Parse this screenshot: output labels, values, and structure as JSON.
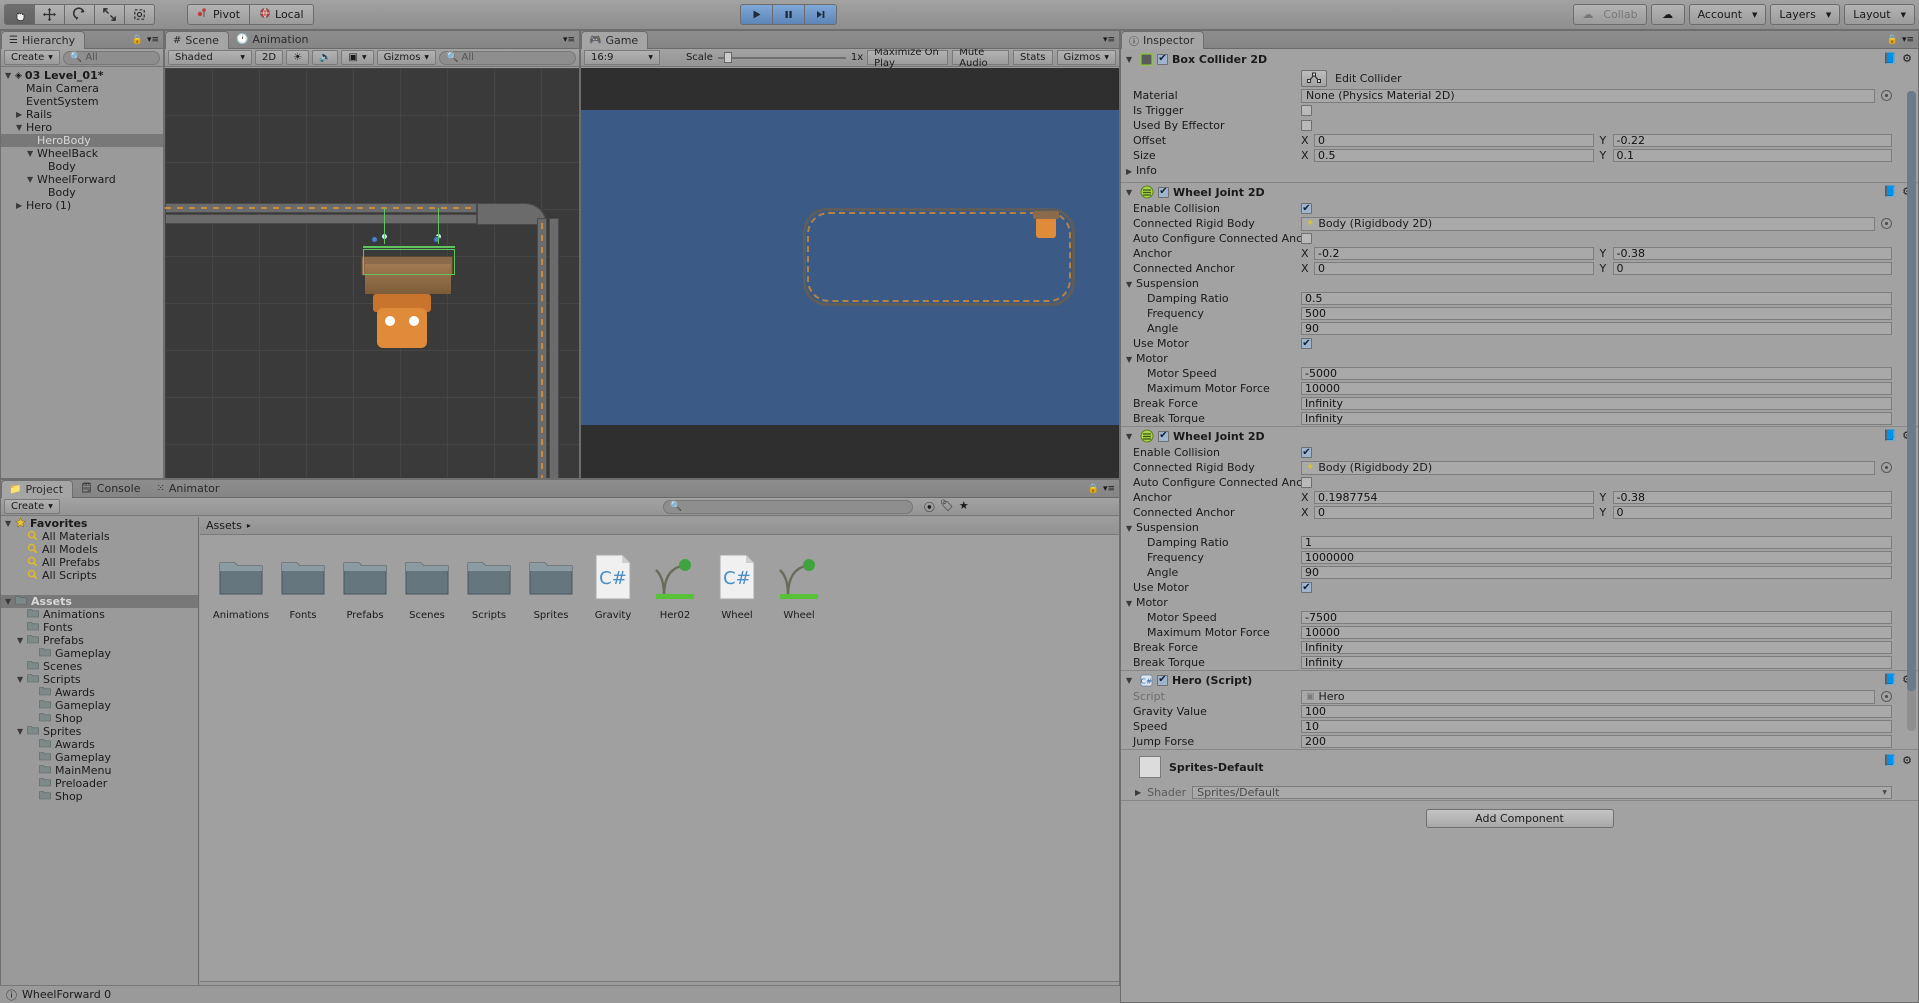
{
  "toolbar": {
    "tools": [
      {
        "name": "hand-tool",
        "glyph": "✋",
        "active": true
      },
      {
        "name": "move-tool",
        "glyph": "✥",
        "active": false
      },
      {
        "name": "rotate-tool",
        "glyph": "⟳",
        "active": false
      },
      {
        "name": "scale-tool",
        "glyph": "⤢",
        "active": false
      },
      {
        "name": "rect-tool",
        "glyph": "⬚",
        "active": false
      }
    ],
    "pivot_label": "Pivot",
    "local_label": "Local",
    "play_label": "▶",
    "pause_label": "❙❙",
    "step_label": "▶❙",
    "collab_label": "Collab",
    "account_label": "Account",
    "layers_label": "Layers",
    "layout_label": "Layout"
  },
  "hierarchy": {
    "tab": "Hierarchy",
    "create_label": "Create",
    "search_placeholder": "All",
    "items": [
      {
        "label": "03 Level_01*",
        "depth": 0,
        "arrow": "▼",
        "bold": true,
        "selected": false,
        "icon": "unity-scene-icon"
      },
      {
        "label": "Main Camera",
        "depth": 1,
        "arrow": "",
        "bold": false,
        "selected": false,
        "icon": ""
      },
      {
        "label": "EventSystem",
        "depth": 1,
        "arrow": "",
        "bold": false,
        "selected": false,
        "icon": ""
      },
      {
        "label": "Rails",
        "depth": 1,
        "arrow": "▶",
        "bold": false,
        "selected": false,
        "icon": ""
      },
      {
        "label": "Hero",
        "depth": 1,
        "arrow": "▼",
        "bold": false,
        "selected": false,
        "icon": ""
      },
      {
        "label": "HeroBody",
        "depth": 2,
        "arrow": "",
        "bold": false,
        "selected": true,
        "icon": ""
      },
      {
        "label": "WheelBack",
        "depth": 2,
        "arrow": "▼",
        "bold": false,
        "selected": false,
        "icon": ""
      },
      {
        "label": "Body",
        "depth": 3,
        "arrow": "",
        "bold": false,
        "selected": false,
        "icon": ""
      },
      {
        "label": "WheelForward",
        "depth": 2,
        "arrow": "▼",
        "bold": false,
        "selected": false,
        "icon": ""
      },
      {
        "label": "Body",
        "depth": 3,
        "arrow": "",
        "bold": false,
        "selected": false,
        "icon": ""
      },
      {
        "label": "Hero (1)",
        "depth": 1,
        "arrow": "▶",
        "bold": false,
        "selected": false,
        "icon": ""
      }
    ]
  },
  "scene": {
    "tab": "Scene",
    "tab2": "Animation",
    "shading_mode": "Shaded",
    "mode_2d": "2D",
    "gizmos_label": "Gizmos",
    "gizmo_search_placeholder": "All"
  },
  "game": {
    "tab": "Game",
    "aspect": "16:9",
    "scale_label": "Scale",
    "scale_value": "1x",
    "maximize_label": "Maximize On Play",
    "mute_label": "Mute Audio",
    "stats_label": "Stats",
    "gizmos_label": "Gizmos"
  },
  "project": {
    "tabs": [
      "Project",
      "Console",
      "Animator"
    ],
    "selected_tab": "Project",
    "create_label": "Create",
    "search_placeholder": "",
    "breadcrumb": "Assets",
    "tree": [
      {
        "label": "Favorites",
        "depth": 0,
        "arrow": "▼",
        "icon": "star-icon",
        "bold": true,
        "selected": false
      },
      {
        "label": "All Materials",
        "depth": 1,
        "arrow": "",
        "icon": "search-icon",
        "bold": false,
        "selected": false
      },
      {
        "label": "All Models",
        "depth": 1,
        "arrow": "",
        "icon": "search-icon",
        "bold": false,
        "selected": false
      },
      {
        "label": "All Prefabs",
        "depth": 1,
        "arrow": "",
        "icon": "search-icon",
        "bold": false,
        "selected": false
      },
      {
        "label": "All Scripts",
        "depth": 1,
        "arrow": "",
        "icon": "search-icon",
        "bold": false,
        "selected": false
      },
      {
        "label": "",
        "depth": 0,
        "arrow": "",
        "icon": "",
        "bold": false,
        "selected": false
      },
      {
        "label": "Assets",
        "depth": 0,
        "arrow": "▼",
        "icon": "folder-icon",
        "bold": true,
        "selected": true
      },
      {
        "label": "Animations",
        "depth": 1,
        "arrow": "",
        "icon": "folder-icon",
        "bold": false,
        "selected": false
      },
      {
        "label": "Fonts",
        "depth": 1,
        "arrow": "",
        "icon": "folder-icon",
        "bold": false,
        "selected": false
      },
      {
        "label": "Prefabs",
        "depth": 1,
        "arrow": "▼",
        "icon": "folder-icon",
        "bold": false,
        "selected": false
      },
      {
        "label": "Gameplay",
        "depth": 2,
        "arrow": "",
        "icon": "folder-icon",
        "bold": false,
        "selected": false
      },
      {
        "label": "Scenes",
        "depth": 1,
        "arrow": "",
        "icon": "folder-icon",
        "bold": false,
        "selected": false
      },
      {
        "label": "Scripts",
        "depth": 1,
        "arrow": "▼",
        "icon": "folder-icon",
        "bold": false,
        "selected": false
      },
      {
        "label": "Awards",
        "depth": 2,
        "arrow": "",
        "icon": "folder-icon",
        "bold": false,
        "selected": false
      },
      {
        "label": "Gameplay",
        "depth": 2,
        "arrow": "",
        "icon": "folder-icon",
        "bold": false,
        "selected": false
      },
      {
        "label": "Shop",
        "depth": 2,
        "arrow": "",
        "icon": "folder-icon",
        "bold": false,
        "selected": false
      },
      {
        "label": "Sprites",
        "depth": 1,
        "arrow": "▼",
        "icon": "folder-icon",
        "bold": false,
        "selected": false
      },
      {
        "label": "Awards",
        "depth": 2,
        "arrow": "",
        "icon": "folder-icon",
        "bold": false,
        "selected": false
      },
      {
        "label": "Gameplay",
        "depth": 2,
        "arrow": "",
        "icon": "folder-icon",
        "bold": false,
        "selected": false
      },
      {
        "label": "MainMenu",
        "depth": 2,
        "arrow": "",
        "icon": "folder-icon",
        "bold": false,
        "selected": false
      },
      {
        "label": "Preloader",
        "depth": 2,
        "arrow": "",
        "icon": "folder-icon",
        "bold": false,
        "selected": false
      },
      {
        "label": "Shop",
        "depth": 2,
        "arrow": "",
        "icon": "folder-icon",
        "bold": false,
        "selected": false
      }
    ],
    "assets": [
      {
        "label": "Animations",
        "type": "folder"
      },
      {
        "label": "Fonts",
        "type": "folder"
      },
      {
        "label": "Prefabs",
        "type": "folder"
      },
      {
        "label": "Scenes",
        "type": "folder"
      },
      {
        "label": "Scripts",
        "type": "folder"
      },
      {
        "label": "Sprites",
        "type": "folder"
      },
      {
        "label": "Gravity",
        "type": "script"
      },
      {
        "label": "Her02",
        "type": "prefab"
      },
      {
        "label": "Wheel",
        "type": "script"
      },
      {
        "label": "Wheel",
        "type": "prefab"
      }
    ]
  },
  "statusbar": {
    "message": "WheelForward 0"
  },
  "inspector": {
    "tab": "Inspector",
    "add_component_label": "Add Component",
    "components": [
      {
        "name": "Box Collider 2D",
        "enabled": true,
        "icon": "box-collider-icon",
        "edit_collider_label": "Edit Collider",
        "rows": [
          {
            "label": "Material",
            "type": "object",
            "value": "None (Physics Material 2D)",
            "indent": 0
          },
          {
            "label": "Is Trigger",
            "type": "checkbox",
            "checked": false,
            "indent": 0
          },
          {
            "label": "Used By Effector",
            "type": "checkbox",
            "checked": false,
            "indent": 0
          },
          {
            "label": "Offset",
            "type": "vec2",
            "x": "0",
            "y": "-0.22",
            "indent": 0
          },
          {
            "label": "Size",
            "type": "vec2",
            "x": "0.5",
            "y": "0.1",
            "indent": 0
          },
          {
            "label": "Info",
            "type": "foldout",
            "arrow": "▶",
            "indent": 0
          }
        ]
      },
      {
        "name": "Wheel Joint 2D",
        "enabled": true,
        "icon": "joint-icon",
        "rows": [
          {
            "label": "Enable Collision",
            "type": "checkbox",
            "checked": true,
            "indent": 0
          },
          {
            "label": "Connected Rigid Body",
            "type": "object",
            "value": "Body (Rigidbody 2D)",
            "indent": 0
          },
          {
            "label": "Auto Configure Connected Anchor",
            "type": "checkbox",
            "checked": false,
            "indent": 0
          },
          {
            "label": "Anchor",
            "type": "vec2",
            "x": "-0.2",
            "y": "-0.38",
            "indent": 0
          },
          {
            "label": "Connected Anchor",
            "type": "vec2",
            "x": "0",
            "y": "0",
            "indent": 0
          },
          {
            "label": "Suspension",
            "type": "foldout",
            "arrow": "▼",
            "indent": 0
          },
          {
            "label": "Damping Ratio",
            "type": "text",
            "value": "0.5",
            "indent": 1
          },
          {
            "label": "Frequency",
            "type": "text",
            "value": "500",
            "indent": 1
          },
          {
            "label": "Angle",
            "type": "text",
            "value": "90",
            "indent": 1
          },
          {
            "label": "Use Motor",
            "type": "checkbox",
            "checked": true,
            "indent": 0
          },
          {
            "label": "Motor",
            "type": "foldout",
            "arrow": "▼",
            "indent": 0
          },
          {
            "label": "Motor Speed",
            "type": "text",
            "value": "-5000",
            "indent": 1
          },
          {
            "label": "Maximum Motor Force",
            "type": "text",
            "value": "10000",
            "indent": 1
          },
          {
            "label": "Break Force",
            "type": "text",
            "value": "Infinity",
            "indent": 0
          },
          {
            "label": "Break Torque",
            "type": "text",
            "value": "Infinity",
            "indent": 0
          }
        ]
      },
      {
        "name": "Wheel Joint 2D",
        "enabled": true,
        "icon": "joint-icon",
        "rows": [
          {
            "label": "Enable Collision",
            "type": "checkbox",
            "checked": true,
            "indent": 0
          },
          {
            "label": "Connected Rigid Body",
            "type": "object",
            "value": "Body (Rigidbody 2D)",
            "indent": 0
          },
          {
            "label": "Auto Configure Connected Anchor",
            "type": "checkbox",
            "checked": false,
            "indent": 0
          },
          {
            "label": "Anchor",
            "type": "vec2",
            "x": "0.1987754",
            "y": "-0.38",
            "indent": 0
          },
          {
            "label": "Connected Anchor",
            "type": "vec2",
            "x": "0",
            "y": "0",
            "indent": 0
          },
          {
            "label": "Suspension",
            "type": "foldout",
            "arrow": "▼",
            "indent": 0
          },
          {
            "label": "Damping Ratio",
            "type": "text",
            "value": "1",
            "indent": 1
          },
          {
            "label": "Frequency",
            "type": "text",
            "value": "1000000",
            "indent": 1
          },
          {
            "label": "Angle",
            "type": "text",
            "value": "90",
            "indent": 1
          },
          {
            "label": "Use Motor",
            "type": "checkbox",
            "checked": true,
            "indent": 0
          },
          {
            "label": "Motor",
            "type": "foldout",
            "arrow": "▼",
            "indent": 0
          },
          {
            "label": "Motor Speed",
            "type": "text",
            "value": "-7500",
            "indent": 1
          },
          {
            "label": "Maximum Motor Force",
            "type": "text",
            "value": "10000",
            "indent": 1
          },
          {
            "label": "Break Force",
            "type": "text",
            "value": "Infinity",
            "indent": 0
          },
          {
            "label": "Break Torque",
            "type": "text",
            "value": "Infinity",
            "indent": 0
          }
        ]
      },
      {
        "name": "Hero (Script)",
        "enabled": true,
        "icon": "csharp-script-icon",
        "rows": [
          {
            "label": "Script",
            "type": "object-dim",
            "value": "Hero",
            "indent": 0
          },
          {
            "label": "Gravity Value",
            "type": "text",
            "value": "100",
            "indent": 0
          },
          {
            "label": "Speed",
            "type": "text",
            "value": "10",
            "indent": 0
          },
          {
            "label": "Jump Forse",
            "type": "text",
            "value": "200",
            "indent": 0
          }
        ]
      }
    ],
    "material": {
      "name": "Sprites-Default",
      "shader_label": "Shader",
      "shader_value": "Sprites/Default"
    }
  }
}
